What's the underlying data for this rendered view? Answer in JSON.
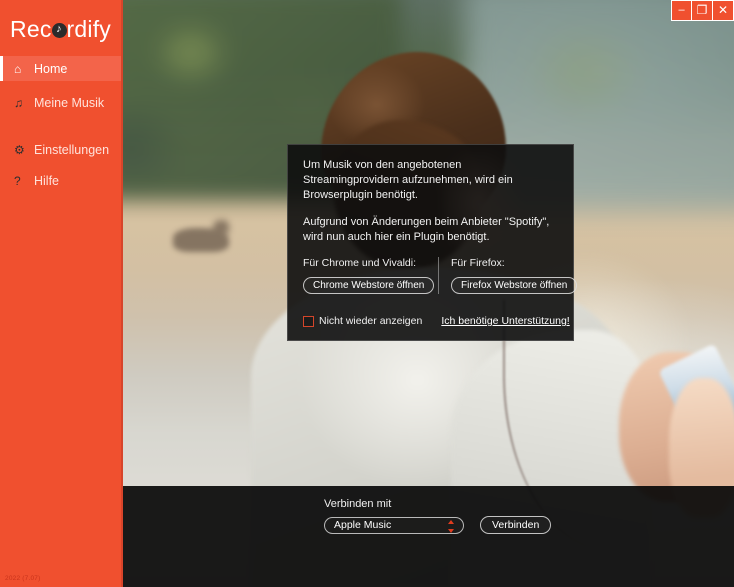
{
  "window": {
    "controls": [
      {
        "name": "minimize",
        "glyph": "–"
      },
      {
        "name": "restore",
        "glyph": "❐"
      },
      {
        "name": "close",
        "glyph": "✕"
      }
    ]
  },
  "sidebar": {
    "brand_part1": "Rec",
    "brand_part2": "rdify",
    "version": "2022 (7.07)",
    "items": [
      {
        "label": "Home",
        "icon": "home-icon",
        "glyph": "⌂",
        "active": true
      },
      {
        "label": "Meine Musik",
        "icon": "music-note-icon",
        "glyph": "♫",
        "active": false
      },
      {
        "label": "Einstellungen",
        "icon": "gear-icon",
        "glyph": "⚙",
        "active": false
      },
      {
        "label": "Hilfe",
        "icon": "question-mark-icon",
        "glyph": "?",
        "active": false
      }
    ]
  },
  "dialog": {
    "paragraph1": "Um Musik von den angebotenen Streamingprovidern aufzunehmen, wird ein Browserplugin benötigt.",
    "paragraph2": "Aufgrund von Änderungen beim Anbieter \"Spotify\", wird nun auch hier ein Plugin benötigt.",
    "chrome_label": "Für Chrome und Vivaldi:",
    "chrome_button": "Chrome Webstore öffnen",
    "firefox_label": "Für Firefox:",
    "firefox_button": "Firefox Webstore öffnen",
    "checkbox_label": "Nicht wieder anzeigen",
    "checkbox_checked": false,
    "support_link": "Ich benötige Unterstützung!"
  },
  "bottom_bar": {
    "connect_with_label": "Verbinden mit",
    "provider_selected": "Apple Music",
    "connect_button": "Verbinden"
  },
  "colors": {
    "brand_orange": "#f0502f",
    "brand_orange_active": "#f3644a",
    "accent_red": "#e03c1e",
    "dialog_bg": "#0e0e0e",
    "text_light": "#f1f1f1"
  }
}
